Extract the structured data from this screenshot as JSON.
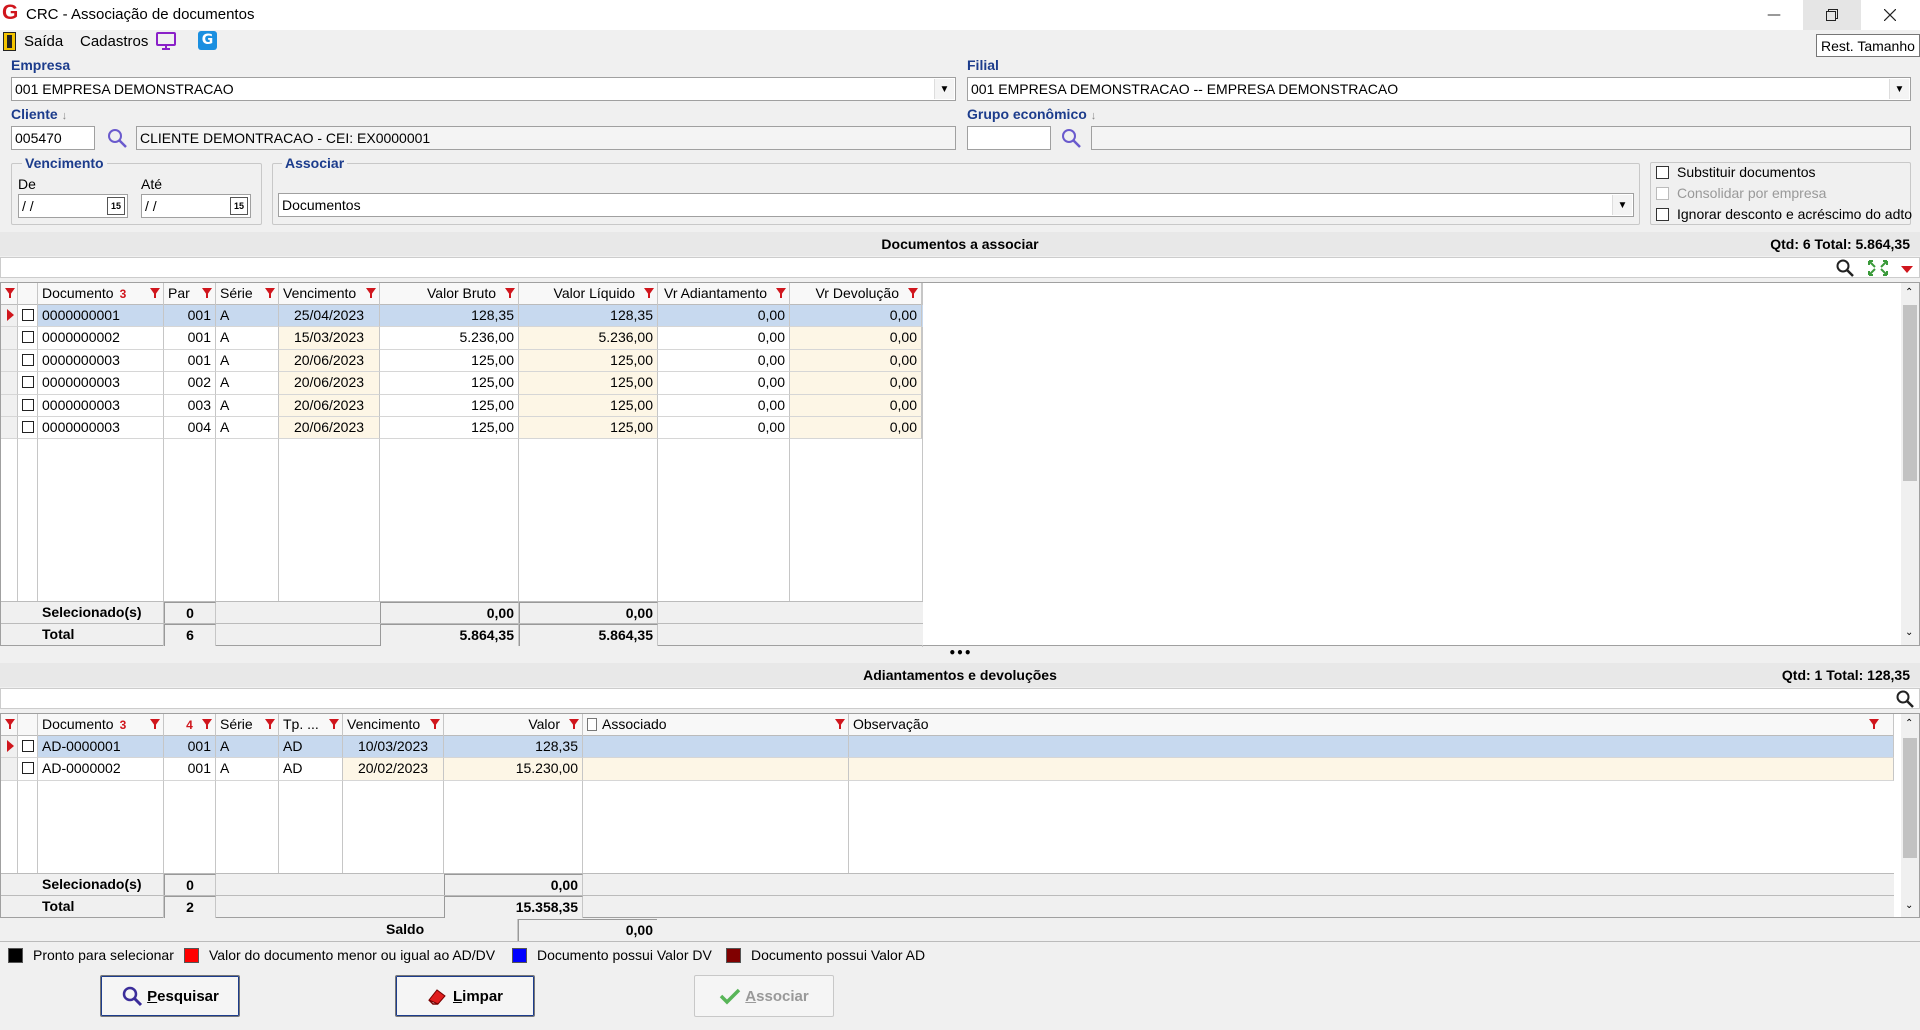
{
  "window": {
    "title": "CRC - Associação de documentos",
    "app_logo": "G"
  },
  "menu": {
    "saida": "Saída",
    "cadastros": "Cadastros"
  },
  "tooltip": "Rest. Tamanho",
  "empresa": {
    "label": "Empresa",
    "value": "001 EMPRESA DEMONSTRACAO"
  },
  "filial": {
    "label": "Filial",
    "value": "001 EMPRESA DEMONSTRACAO -- EMPRESA DEMONSTRACAO"
  },
  "cliente": {
    "label": "Cliente",
    "code": "005470",
    "name": "CLIENTE DEMONTRACAO - CEI: EX0000001"
  },
  "grupo": {
    "label": "Grupo econômico",
    "code": "",
    "name": ""
  },
  "vencimento": {
    "title": "Vencimento",
    "de_label": "De",
    "ate_label": "Até",
    "de_value": " / /",
    "ate_value": " / /",
    "cal_label": "15"
  },
  "associar": {
    "title": "Associar",
    "value": "Documentos"
  },
  "options": {
    "substituir": "Substituir documentos",
    "consolidar": "Consolidar por empresa",
    "ignorar": "Ignorar desconto e acréscimo do adto"
  },
  "docs": {
    "title": "Documentos a associar",
    "summary": "Qtd: 6 Total: 5.864,35",
    "headers": {
      "documento": "Documento",
      "sort": "3",
      "par": "Par",
      "serie": "Série",
      "vencimento": "Vencimento",
      "valor_bruto": "Valor Bruto",
      "valor_liquido": "Valor Líquido",
      "vr_adiantamento": "Vr Adiantamento",
      "vr_devolucao": "Vr Devolução"
    },
    "rows": [
      {
        "documento": "0000000001",
        "par": "001",
        "serie": "A",
        "vencimento": "25/04/2023",
        "bruto": "128,35",
        "liquido": "128,35",
        "adto": "0,00",
        "dev": "0,00"
      },
      {
        "documento": "0000000002",
        "par": "001",
        "serie": "A",
        "vencimento": "15/03/2023",
        "bruto": "5.236,00",
        "liquido": "5.236,00",
        "adto": "0,00",
        "dev": "0,00"
      },
      {
        "documento": "0000000003",
        "par": "001",
        "serie": "A",
        "vencimento": "20/06/2023",
        "bruto": "125,00",
        "liquido": "125,00",
        "adto": "0,00",
        "dev": "0,00"
      },
      {
        "documento": "0000000003",
        "par": "002",
        "serie": "A",
        "vencimento": "20/06/2023",
        "bruto": "125,00",
        "liquido": "125,00",
        "adto": "0,00",
        "dev": "0,00"
      },
      {
        "documento": "0000000003",
        "par": "003",
        "serie": "A",
        "vencimento": "20/06/2023",
        "bruto": "125,00",
        "liquido": "125,00",
        "adto": "0,00",
        "dev": "0,00"
      },
      {
        "documento": "0000000003",
        "par": "004",
        "serie": "A",
        "vencimento": "20/06/2023",
        "bruto": "125,00",
        "liquido": "125,00",
        "adto": "0,00",
        "dev": "0,00"
      }
    ],
    "footer": {
      "selecionados_label": "Selecionado(s)",
      "selecionados_count": "0",
      "selecionados_bruto": "0,00",
      "selecionados_liquido": "0,00",
      "total_label": "Total",
      "total_count": "6",
      "total_bruto": "5.864,35",
      "total_liquido": "5.864,35"
    }
  },
  "splitter": "•••",
  "adtos": {
    "title": "Adiantamentos e devoluções",
    "summary": "Qtd: 1 Total: 128,35",
    "headers": {
      "documento": "Documento",
      "sort1": "3",
      "sort2": "4",
      "serie": "Série",
      "tp": "Tp. ...",
      "vencimento": "Vencimento",
      "valor": "Valor",
      "associado": "Associado",
      "observacao": "Observação"
    },
    "rows": [
      {
        "documento": "AD-0000001",
        "par": "001",
        "serie": "A",
        "tp": "AD",
        "vencimento": "10/03/2023",
        "valor": "128,35",
        "associado": "",
        "observacao": ""
      },
      {
        "documento": "AD-0000002",
        "par": "001",
        "serie": "A",
        "tp": "AD",
        "vencimento": "20/02/2023",
        "valor": "15.230,00",
        "associado": "",
        "observacao": ""
      }
    ],
    "footer": {
      "selecionados_label": "Selecionado(s)",
      "selecionados_count": "0",
      "selecionados_valor": "0,00",
      "total_label": "Total",
      "total_count": "2",
      "total_valor": "15.358,35"
    }
  },
  "saldo": {
    "label": "Saldo",
    "value": "0,00"
  },
  "legend": [
    {
      "label": "Pronto para selecionar",
      "color": "#000000"
    },
    {
      "label": "Valor do documento menor ou igual ao AD/DV",
      "color": "#ff0000"
    },
    {
      "label": "Documento possui Valor DV",
      "color": "#0000ff"
    },
    {
      "label": "Documento possui Valor AD",
      "color": "#800000"
    }
  ],
  "buttons": {
    "pesquisar_u": "P",
    "pesquisar_rest": "esquisar",
    "limpar_u": "L",
    "limpar_rest": "impar",
    "associar_u": "A",
    "associar_rest": "ssociar"
  }
}
